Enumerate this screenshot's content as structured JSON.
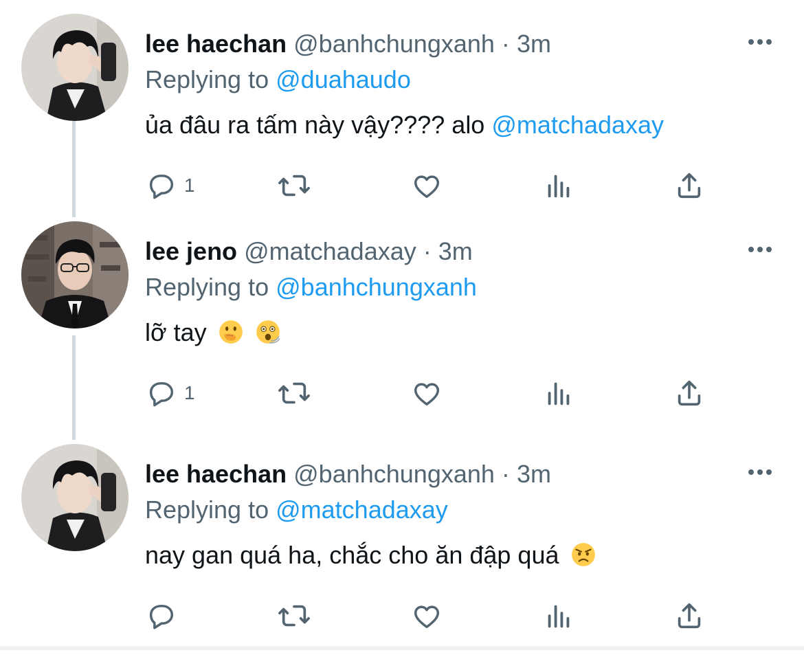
{
  "thread": [
    {
      "name": "lee haechan",
      "handle": "@banhchungxanh",
      "separator": "·",
      "time": "3m",
      "reply_prefix": "Replying to",
      "reply_to": "@duahaudo",
      "text": "ủa đâu ra tấm này vậy???? alo",
      "text_mention": "@matchadaxay",
      "emojis": [],
      "reply_count": "1",
      "avatar": "avatar-haechan"
    },
    {
      "name": "lee jeno",
      "handle": "@matchadaxay",
      "separator": "·",
      "time": "3m",
      "reply_prefix": "Replying to",
      "reply_to": "@banhchungxanh",
      "text": "lỡ tay",
      "text_mention": "",
      "emojis": [
        "face-with-hand-over-mouth",
        "astonished-dizzy-face"
      ],
      "reply_count": "1",
      "avatar": "avatar-jeno"
    },
    {
      "name": "lee haechan",
      "handle": "@banhchungxanh",
      "separator": "·",
      "time": "3m",
      "reply_prefix": "Replying to",
      "reply_to": "@matchadaxay",
      "text": "nay gan quá ha, chắc cho ăn đập quá",
      "text_mention": "",
      "emojis": [
        "angry-face"
      ],
      "reply_count": "",
      "avatar": "avatar-haechan"
    }
  ],
  "icons": {
    "more": "more-horizontal-icon",
    "reply": "reply-bubble-icon",
    "retweet": "retweet-icon",
    "like": "heart-icon",
    "views": "analytics-icon",
    "share": "share-icon"
  },
  "colors": {
    "text": "#0f1419",
    "secondary": "#536471",
    "mention": "#1d9bf0",
    "thread_line": "#cfd9de"
  }
}
